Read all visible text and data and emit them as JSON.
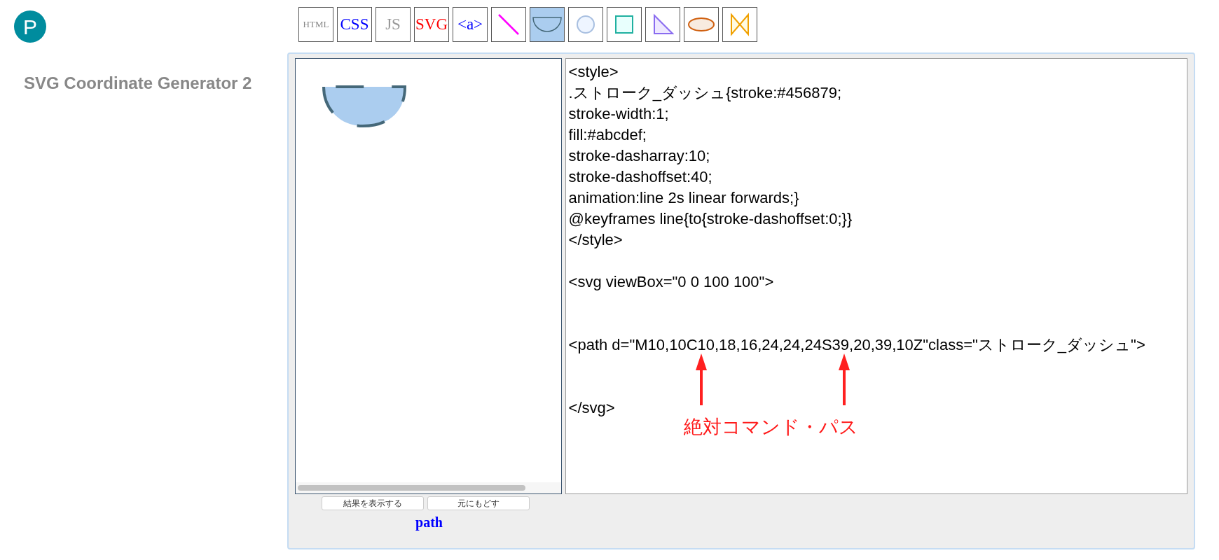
{
  "logo": {
    "letter": "P"
  },
  "app_title": "SVG Coordinate Generator 2",
  "toolbar": [
    {
      "kind": "text",
      "label": "HTML",
      "color": "#888888",
      "selected": false
    },
    {
      "kind": "text",
      "label": "CSS",
      "color": "#0000ff",
      "selected": false
    },
    {
      "kind": "text",
      "label": "JS",
      "color": "#999999",
      "selected": false
    },
    {
      "kind": "text",
      "label": "SVG",
      "color": "#ff0000",
      "selected": false
    },
    {
      "kind": "text",
      "label": "<a>",
      "color": "#0000ff",
      "selected": false
    },
    {
      "kind": "line",
      "selected": false
    },
    {
      "kind": "half-circle",
      "selected": true
    },
    {
      "kind": "circle",
      "selected": false
    },
    {
      "kind": "square",
      "selected": false
    },
    {
      "kind": "triangle",
      "selected": false
    },
    {
      "kind": "ellipse",
      "selected": false
    },
    {
      "kind": "bowtie",
      "selected": false
    }
  ],
  "code": "<style>\n.ストローク_ダッシュ{stroke:#456879;\nstroke-width:1;\nfill:#abcdef;\nstroke-dasharray:10;\nstroke-dashoffset:40;\nanimation:line 2s linear forwards;}\n@keyframes line{to{stroke-dashoffset:0;}}\n</style>\n\n<svg viewBox=\"0 0 100 100\">\n\n\n<path d=\"M10,10C10,18,16,24,24,24S39,20,39,10Z\"class=\"ストローク_ダッシュ\">\n\n\n</svg>",
  "buttons": [
    "結果を表示する",
    "元にもどす"
  ],
  "shape_name": "path",
  "annotation": "絶対コマンド・パス"
}
